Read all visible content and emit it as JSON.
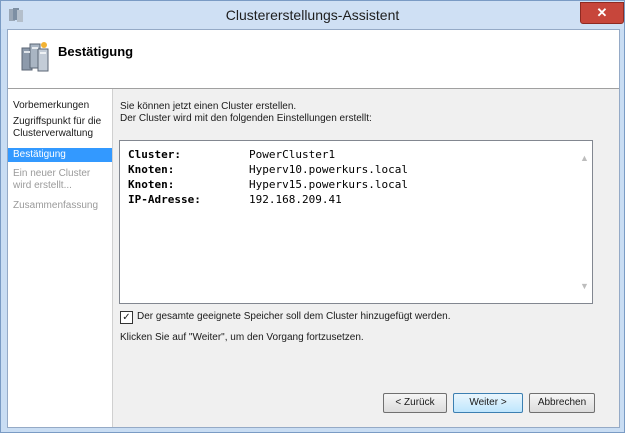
{
  "window": {
    "title": "Clustererstellungs-Assistent",
    "close_label": "✕"
  },
  "header": {
    "title": "Bestätigung"
  },
  "nav": [
    {
      "label": "Vorbemerkungen",
      "state": "normal"
    },
    {
      "label": "Zugriffspunkt für die Clusterverwaltung",
      "state": "normal"
    },
    {
      "label": "Bestätigung",
      "state": "selected"
    },
    {
      "label": "Ein neuer Cluster wird erstellt...",
      "state": "disabled"
    },
    {
      "label": "Zusammenfassung",
      "state": "disabled"
    }
  ],
  "content": {
    "intro_line1": "Sie können jetzt einen Cluster erstellen.",
    "intro_line2": "Der Cluster wird mit den folgenden Einstellungen erstellt:",
    "settings": [
      {
        "key": "Cluster:",
        "value": "PowerCluster1"
      },
      {
        "key": "Knoten:",
        "value": "Hyperv10.powerkurs.local"
      },
      {
        "key": "Knoten:",
        "value": "Hyperv15.powerkurs.local"
      },
      {
        "key": "IP-Adresse:",
        "value": "192.168.209.41"
      }
    ],
    "storage_checkbox_label": "Der gesamte geeignete Speicher soll dem Cluster hinzugefügt werden.",
    "storage_checked": true,
    "hint": "Klicken Sie auf \"Weiter\", um den Vorgang fortzusetzen."
  },
  "buttons": {
    "back": "< Zurück",
    "next": "Weiter >",
    "cancel": "Abbrechen"
  }
}
